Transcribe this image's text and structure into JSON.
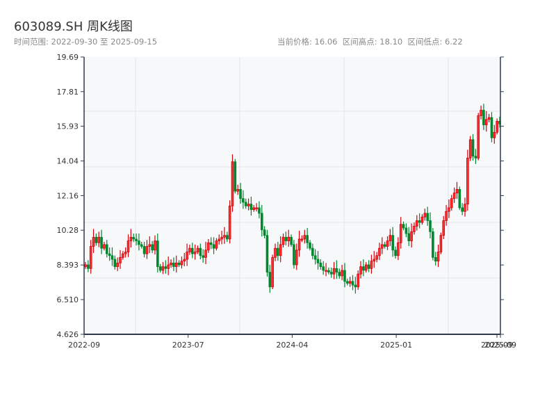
{
  "header": {
    "title": "603089.SH 周K线图",
    "range_label": "时间范围: 2022-09-30 至 2025-09-15",
    "stats_label": "当前价格: 16.06  区间高点: 18.10  区间低点: 6.22"
  },
  "chart_data": {
    "type": "candlestick",
    "title": "603089.SH 周K线图",
    "subtitle": "时间范围: 2022-09-30 至 2025-09-15",
    "period": "weekly",
    "start_date": "2022-09-30",
    "end_date": "2025-09-15",
    "current_price": 16.06,
    "range_high": 18.1,
    "range_low": 6.22,
    "ylim": [
      4.626,
      19.69
    ],
    "y_ticks": [
      "4.626",
      "6.510",
      "8.393",
      "10.28",
      "12.16",
      "14.04",
      "15.93",
      "17.81",
      "19.69"
    ],
    "x_ticks": [
      "2022-09",
      "2023-07",
      "2024-04",
      "2025-01",
      "2025-09",
      "2025-09"
    ],
    "up_color": "#d4000b",
    "down_color": "#00882e",
    "grid": true,
    "close": [
      8.4,
      8.2,
      9.4,
      9.9,
      9.6,
      9.9,
      9.3,
      9.5,
      9.0,
      8.9,
      8.7,
      8.3,
      8.5,
      8.8,
      9.0,
      9.1,
      9.7,
      9.9,
      9.8,
      9.7,
      9.5,
      9.4,
      9.0,
      9.4,
      9.5,
      9.2,
      9.7,
      8.3,
      8.1,
      8.3,
      8.2,
      8.4,
      8.5,
      8.3,
      8.5,
      8.4,
      8.6,
      8.7,
      9.1,
      9.3,
      9.0,
      9.1,
      9.3,
      8.9,
      8.8,
      9.2,
      9.6,
      9.5,
      9.3,
      9.7,
      9.8,
      9.9,
      10.0,
      9.8,
      11.6,
      14.0,
      12.4,
      12.5,
      12.0,
      11.8,
      11.6,
      11.7,
      11.4,
      11.5,
      11.5,
      11.2,
      10.3,
      10.0,
      8.0,
      7.2,
      8.8,
      9.3,
      8.9,
      9.5,
      9.9,
      9.7,
      9.9,
      9.5,
      8.4,
      9.2,
      9.8,
      9.8,
      10.0,
      9.6,
      9.3,
      8.9,
      8.7,
      8.5,
      8.3,
      8.1,
      8.1,
      8.0,
      7.9,
      8.2,
      8.0,
      7.8,
      8.1,
      7.5,
      7.4,
      7.5,
      7.3,
      7.2,
      7.9,
      8.3,
      8.1,
      8.4,
      8.2,
      8.6,
      8.7,
      8.9,
      9.3,
      9.5,
      9.4,
      9.7,
      10.0,
      9.2,
      8.9,
      9.6,
      10.6,
      10.4,
      10.1,
      9.7,
      10.2,
      10.5,
      10.8,
      10.7,
      11.0,
      11.2,
      10.8,
      10.2,
      8.8,
      8.6,
      9.1,
      10.0,
      10.8,
      11.3,
      11.5,
      12.0,
      12.3,
      12.5,
      11.5,
      11.3,
      11.7,
      14.2,
      15.2,
      14.3,
      14.2,
      16.5,
      16.8,
      16.0,
      16.3,
      16.4,
      15.3,
      15.6,
      16.2,
      16.06
    ]
  }
}
